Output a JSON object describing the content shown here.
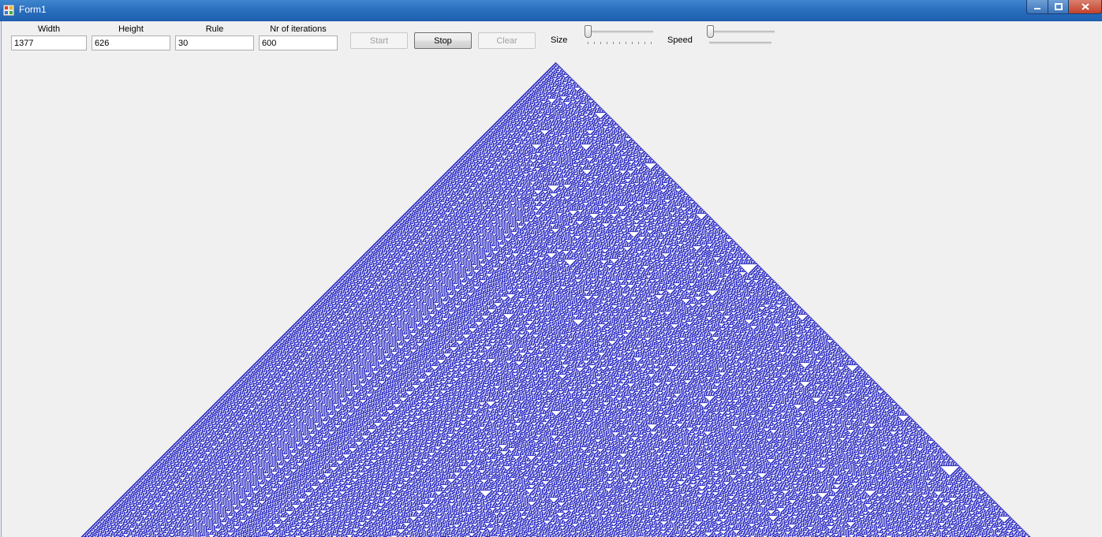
{
  "window": {
    "title": "Form1"
  },
  "controls": {
    "width": {
      "label": "Width",
      "value": "1377"
    },
    "height": {
      "label": "Height",
      "value": "626"
    },
    "rule": {
      "label": "Rule",
      "value": "30"
    },
    "iterations": {
      "label": "Nr of iterations",
      "value": "600"
    },
    "start_label": "Start",
    "stop_label": "Stop",
    "clear_label": "Clear",
    "size_label": "Size",
    "speed_label": "Speed",
    "size_level": 0,
    "speed_level": 0
  },
  "automaton": {
    "rule": 30,
    "cell_color": "#0000b4",
    "background_color": "#ffffff"
  },
  "colors": {
    "titlebar": "#2a6fbf",
    "window_bg": "#f0f0f0"
  }
}
